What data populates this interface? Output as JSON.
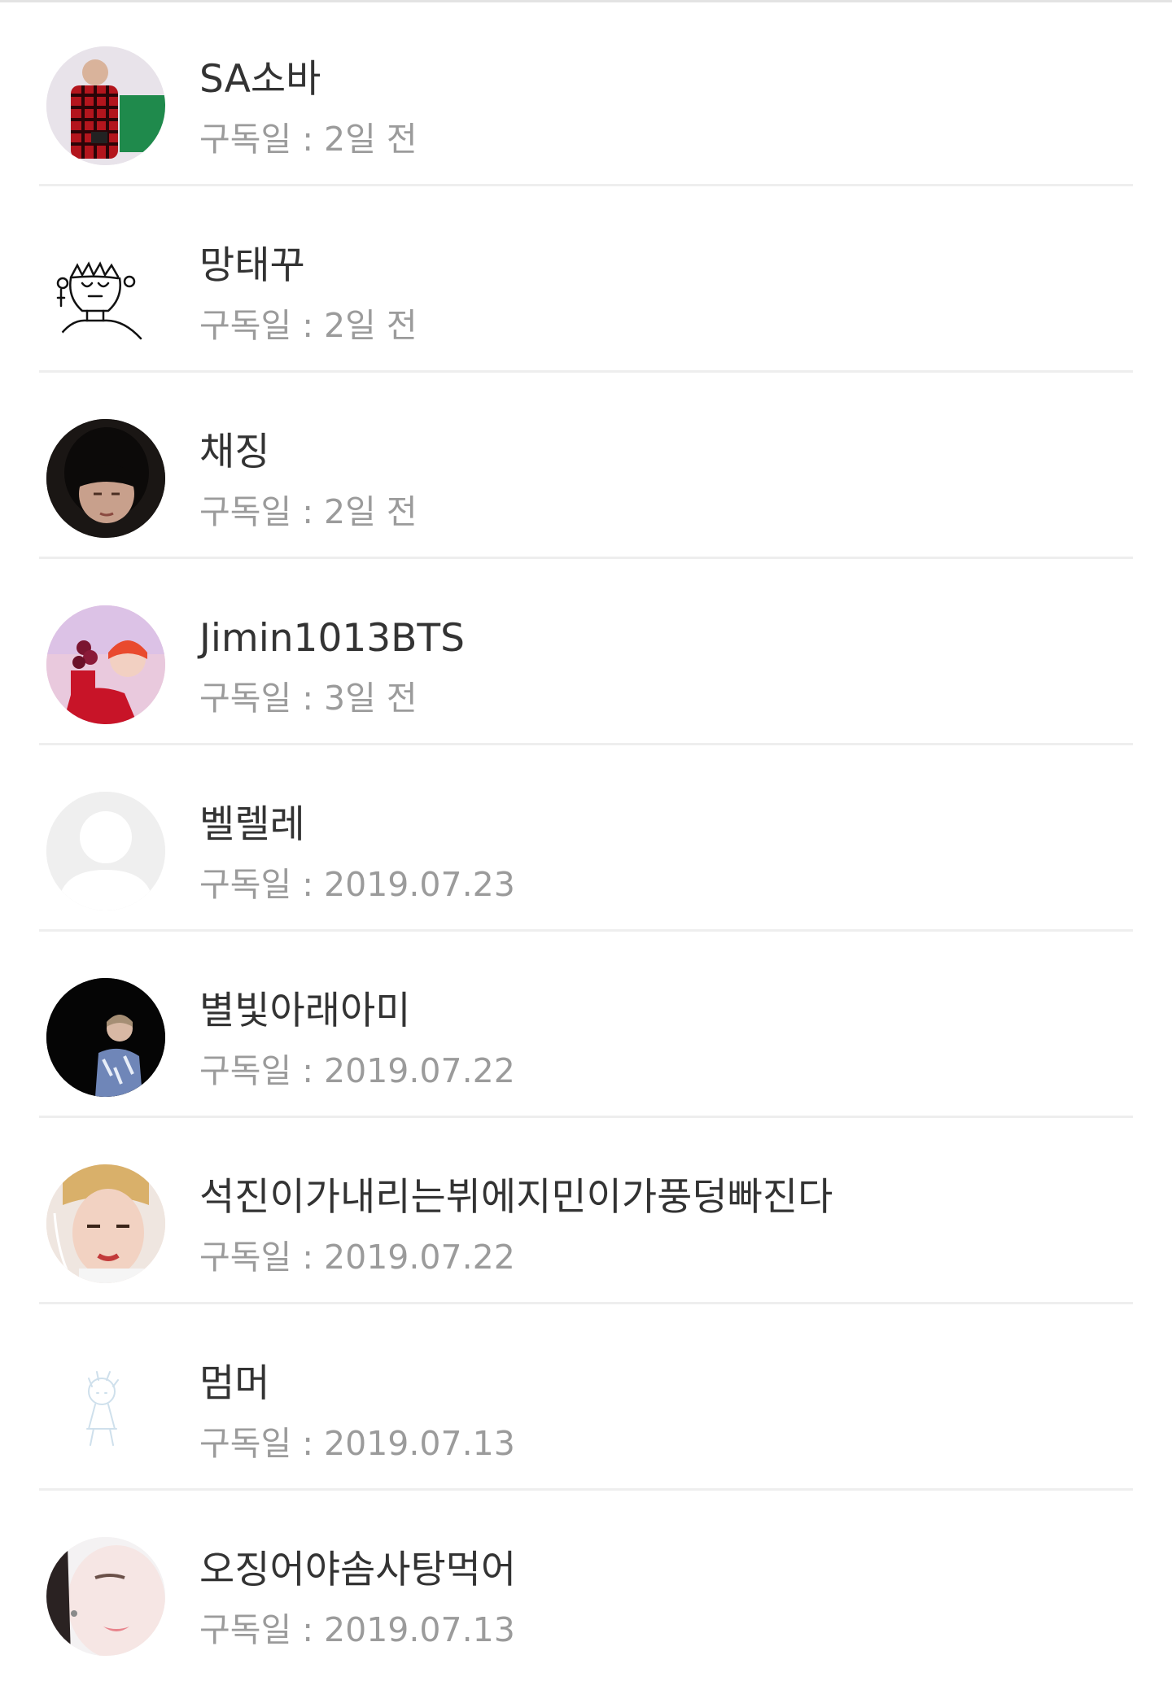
{
  "date_prefix": "구독일 : ",
  "subscribers": [
    {
      "name": "SA소바",
      "date": "2일 전",
      "avatar": "photo-red-plaid"
    },
    {
      "name": "망태꾸",
      "date": "2일 전",
      "avatar": "sketch-face"
    },
    {
      "name": "채징",
      "date": "2일 전",
      "avatar": "photo-dark"
    },
    {
      "name": "Jimin1013BTS",
      "date": "3일 전",
      "avatar": "photo-pink-hair"
    },
    {
      "name": "벨렐레",
      "date": "2019.07.23",
      "avatar": "default-silhouette"
    },
    {
      "name": "별빛아래아미",
      "date": "2019.07.22",
      "avatar": "photo-night"
    },
    {
      "name": "석진이가내리는뷔에지민이가풍덩빠진다",
      "date": "2019.07.22",
      "avatar": "photo-closeup"
    },
    {
      "name": "멈머",
      "date": "2019.07.13",
      "avatar": "faint-sketch"
    },
    {
      "name": "오징어야솜사탕먹어",
      "date": "2019.07.13",
      "avatar": "photo-pale-face"
    }
  ]
}
